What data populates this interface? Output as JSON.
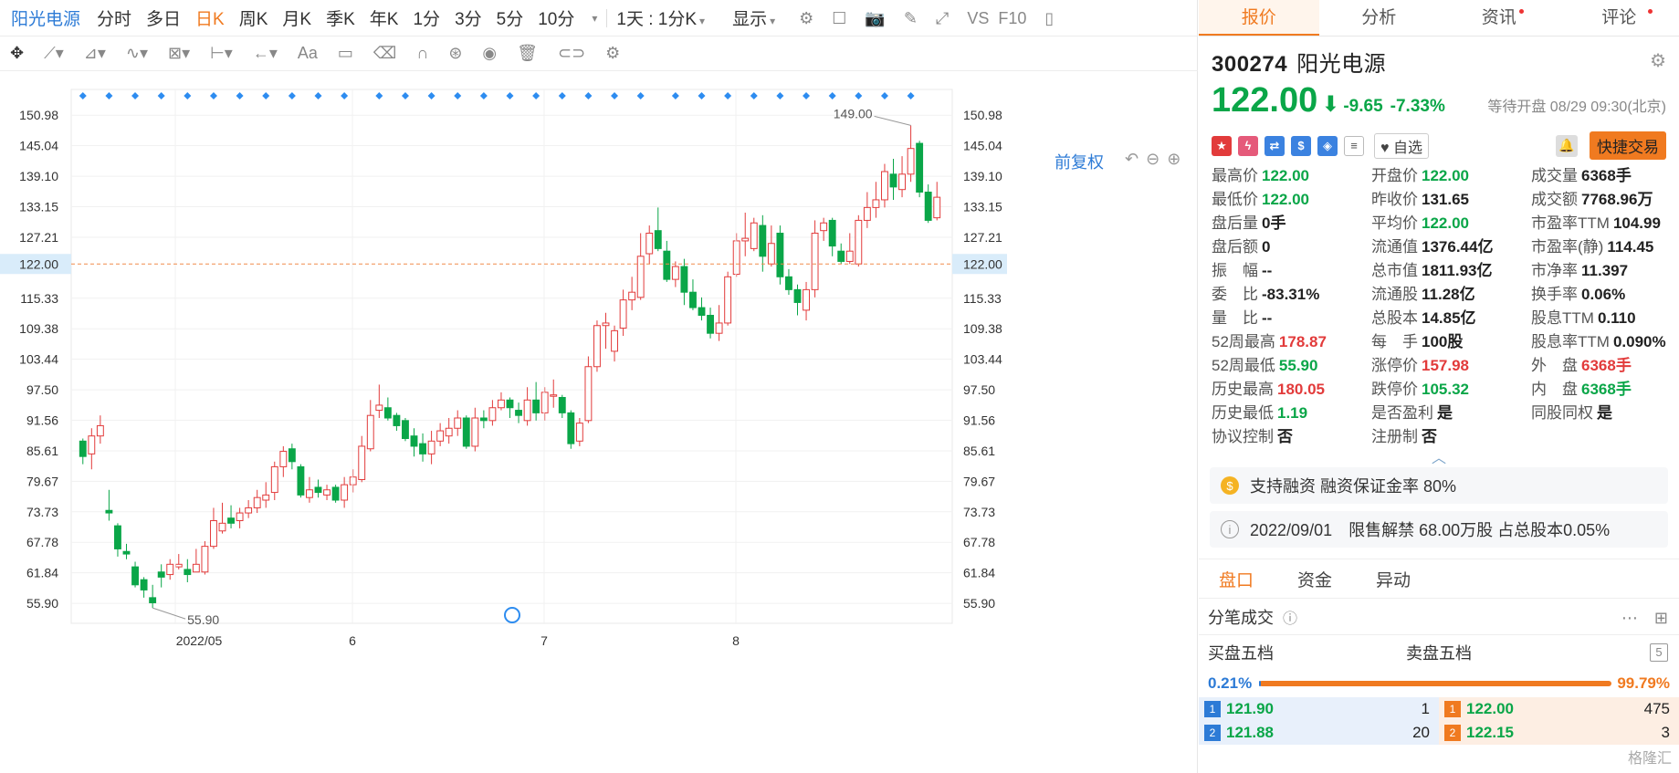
{
  "toolbar": {
    "stock_name": "阳光电源",
    "periods": [
      "分时",
      "多日",
      "日K",
      "周K",
      "月K",
      "季K",
      "年K",
      "1分",
      "3分",
      "5分",
      "10分"
    ],
    "active_period": "日K",
    "range_select": "1天 : 1分K",
    "display_label": "显示",
    "vs_label": "VS",
    "f10_label": "F10"
  },
  "chart": {
    "fuquan_label": "前复权"
  },
  "chart_data": {
    "type": "candlestick",
    "x_labels": [
      "2022/05",
      "6",
      "7",
      "8"
    ],
    "y_ticks": [
      150.98,
      145.04,
      139.1,
      133.15,
      127.21,
      122.0,
      115.33,
      109.38,
      103.44,
      97.5,
      91.56,
      85.61,
      79.67,
      73.73,
      67.78,
      61.84,
      55.9
    ],
    "current_price": 122.0,
    "high_label": "149.00",
    "low_label": "55.90",
    "ylim": [
      52.0,
      156.0
    ],
    "candles": [
      [
        87.5,
        84.5,
        88.0,
        83.0
      ],
      [
        85.0,
        88.5,
        90.0,
        82.0
      ],
      [
        88.5,
        90.5,
        92.5,
        87.0
      ],
      [
        74.0,
        73.5,
        78.0,
        72.0
      ],
      [
        71.0,
        66.5,
        71.5,
        65.0
      ],
      [
        66.0,
        65.5,
        67.5,
        64.5
      ],
      [
        63.0,
        59.5,
        64.0,
        59.0
      ],
      [
        60.5,
        58.5,
        61.0,
        57.0
      ],
      [
        57.0,
        56.0,
        59.5,
        55.0
      ],
      [
        62.0,
        61.0,
        63.5,
        59.0
      ],
      [
        61.5,
        63.5,
        64.5,
        60.5
      ],
      [
        63.0,
        63.5,
        65.5,
        62.5
      ],
      [
        62.5,
        61.5,
        64.5,
        60.0
      ],
      [
        62.0,
        63.5,
        66.5,
        62.0
      ],
      [
        62.0,
        67.0,
        68.0,
        61.5
      ],
      [
        67.0,
        72.0,
        74.5,
        66.5
      ],
      [
        70.0,
        71.5,
        75.5,
        69.5
      ],
      [
        72.5,
        71.5,
        75.0,
        70.5
      ],
      [
        72.0,
        73.5,
        74.5,
        70.5
      ],
      [
        73.5,
        74.5,
        76.0,
        72.5
      ],
      [
        74.5,
        76.5,
        78.0,
        73.5
      ],
      [
        76.0,
        77.0,
        79.5,
        74.5
      ],
      [
        77.5,
        82.5,
        83.5,
        76.0
      ],
      [
        82.5,
        85.5,
        86.5,
        80.5
      ],
      [
        86.0,
        83.5,
        87.0,
        82.0
      ],
      [
        82.5,
        77.0,
        83.0,
        76.5
      ],
      [
        76.5,
        78.0,
        80.5,
        75.5
      ],
      [
        78.5,
        77.5,
        80.0,
        76.5
      ],
      [
        77.0,
        78.0,
        79.0,
        76.0
      ],
      [
        78.5,
        76.0,
        79.0,
        75.5
      ],
      [
        76.0,
        79.0,
        80.5,
        74.5
      ],
      [
        79.0,
        80.5,
        82.0,
        77.5
      ],
      [
        80.0,
        86.5,
        88.5,
        79.5
      ],
      [
        86.0,
        92.5,
        95.5,
        85.5
      ],
      [
        93.5,
        94.5,
        98.5,
        92.0
      ],
      [
        94.0,
        92.0,
        96.0,
        91.5
      ],
      [
        92.5,
        90.5,
        93.0,
        89.5
      ],
      [
        91.5,
        88.0,
        92.0,
        87.5
      ],
      [
        88.5,
        86.5,
        90.0,
        84.5
      ],
      [
        87.0,
        85.0,
        89.0,
        83.5
      ],
      [
        85.0,
        87.5,
        89.5,
        83.0
      ],
      [
        87.5,
        89.5,
        91.0,
        86.5
      ],
      [
        88.5,
        90.0,
        92.0,
        87.0
      ],
      [
        90.0,
        92.0,
        93.5,
        88.5
      ],
      [
        92.0,
        86.5,
        92.5,
        86.0
      ],
      [
        86.5,
        92.0,
        94.0,
        85.5
      ],
      [
        92.0,
        91.5,
        93.5,
        90.0
      ],
      [
        91.5,
        94.0,
        95.5,
        90.5
      ],
      [
        94.0,
        95.5,
        97.0,
        93.5
      ],
      [
        95.5,
        94.0,
        96.0,
        92.0
      ],
      [
        93.5,
        92.5,
        95.0,
        91.0
      ],
      [
        91.5,
        95.5,
        98.0,
        90.5
      ],
      [
        95.5,
        93.0,
        99.0,
        91.5
      ],
      [
        93.0,
        97.0,
        98.0,
        91.5
      ],
      [
        96.5,
        96.5,
        99.5,
        94.0
      ],
      [
        96.0,
        93.0,
        96.5,
        92.0
      ],
      [
        93.0,
        87.0,
        93.5,
        86.0
      ],
      [
        87.5,
        91.0,
        92.0,
        86.5
      ],
      [
        91.5,
        102.0,
        104.0,
        91.0
      ],
      [
        102.0,
        110.0,
        111.0,
        101.0
      ],
      [
        110.0,
        110.5,
        112.5,
        105.5
      ],
      [
        105.0,
        109.0,
        110.0,
        103.0
      ],
      [
        109.5,
        115.0,
        117.0,
        108.0
      ],
      [
        115.0,
        116.5,
        119.5,
        113.0
      ],
      [
        115.5,
        123.5,
        128.0,
        115.0
      ],
      [
        124.0,
        128.0,
        129.5,
        122.0
      ],
      [
        128.5,
        125.0,
        133.0,
        124.5
      ],
      [
        124.5,
        119.0,
        126.5,
        118.5
      ],
      [
        119.0,
        121.5,
        122.5,
        117.5
      ],
      [
        121.5,
        116.5,
        123.0,
        114.0
      ],
      [
        116.5,
        113.5,
        119.0,
        113.0
      ],
      [
        113.5,
        112.0,
        115.5,
        111.0
      ],
      [
        112.0,
        108.5,
        113.5,
        107.5
      ],
      [
        108.5,
        110.5,
        114.0,
        107.0
      ],
      [
        110.5,
        119.5,
        120.5,
        110.0
      ],
      [
        120.0,
        126.5,
        128.0,
        119.5
      ],
      [
        126.5,
        127.0,
        132.0,
        123.5
      ],
      [
        125.0,
        130.0,
        131.0,
        124.5
      ],
      [
        129.5,
        123.5,
        131.5,
        120.5
      ],
      [
        122.0,
        126.0,
        129.5,
        121.5
      ],
      [
        128.0,
        119.5,
        129.5,
        118.0
      ],
      [
        119.5,
        117.0,
        121.0,
        116.0
      ],
      [
        117.0,
        114.5,
        118.0,
        112.0
      ],
      [
        113.0,
        117.0,
        118.5,
        111.0
      ],
      [
        117.0,
        128.0,
        130.5,
        115.5
      ],
      [
        128.5,
        130.0,
        131.0,
        126.5
      ],
      [
        130.5,
        125.5,
        131.0,
        123.5
      ],
      [
        124.5,
        122.5,
        126.0,
        122.0
      ],
      [
        122.5,
        124.5,
        128.0,
        122.0
      ],
      [
        122.0,
        130.5,
        131.5,
        121.5
      ],
      [
        130.5,
        133.0,
        136.0,
        129.0
      ],
      [
        133.0,
        134.5,
        138.0,
        131.0
      ],
      [
        134.5,
        140.0,
        141.5,
        133.0
      ],
      [
        139.5,
        137.0,
        142.5,
        134.5
      ],
      [
        136.5,
        139.5,
        143.0,
        135.0
      ],
      [
        139.5,
        144.5,
        149.0,
        138.0
      ],
      [
        145.5,
        136.0,
        146.0,
        135.0
      ],
      [
        136.0,
        130.5,
        137.5,
        130.0
      ],
      [
        131.0,
        135.0,
        138.0,
        130.5
      ]
    ],
    "markers_count": 32
  },
  "quote": {
    "code": "300274",
    "name": "阳光电源",
    "price": "122.00",
    "change": "-9.65",
    "change_pct": "-7.33%",
    "status": "等待开盘 08/29 09:30(北京)",
    "watch_label": "自选",
    "trade_label": "快捷交易"
  },
  "tabs": [
    "报价",
    "分析",
    "资讯",
    "评论"
  ],
  "active_tab": "报价",
  "stats": [
    [
      {
        "l": "最高价",
        "v": "122.00",
        "c": "g"
      },
      {
        "l": "开盘价",
        "v": "122.00",
        "c": "g"
      },
      {
        "l": "成交量",
        "v": "6368手",
        "c": ""
      }
    ],
    [
      {
        "l": "最低价",
        "v": "122.00",
        "c": "g"
      },
      {
        "l": "昨收价",
        "v": "131.65",
        "c": ""
      },
      {
        "l": "成交额",
        "v": "7768.96万",
        "c": ""
      }
    ],
    [
      {
        "l": "盘后量",
        "v": "0手",
        "c": ""
      },
      {
        "l": "平均价",
        "v": "122.00",
        "c": "g"
      },
      {
        "l": "市盈率TTM",
        "v": "104.99",
        "c": ""
      }
    ],
    [
      {
        "l": "盘后额",
        "v": "0",
        "c": ""
      },
      {
        "l": "流通值",
        "v": "1376.44亿",
        "c": ""
      },
      {
        "l": "市盈率(静)",
        "v": "114.45",
        "c": ""
      }
    ],
    [
      {
        "l": "振　幅",
        "v": "--",
        "c": ""
      },
      {
        "l": "总市值",
        "v": "1811.93亿",
        "c": ""
      },
      {
        "l": "市净率",
        "v": "11.397",
        "c": ""
      }
    ],
    [
      {
        "l": "委　比",
        "v": "-83.31%",
        "c": ""
      },
      {
        "l": "流通股",
        "v": "11.28亿",
        "c": ""
      },
      {
        "l": "换手率",
        "v": "0.06%",
        "c": ""
      }
    ],
    [
      {
        "l": "量　比",
        "v": "--",
        "c": ""
      },
      {
        "l": "总股本",
        "v": "14.85亿",
        "c": ""
      },
      {
        "l": "股息TTM",
        "v": "0.110",
        "c": ""
      }
    ],
    [
      {
        "l": "52周最高",
        "v": "178.87",
        "c": "r"
      },
      {
        "l": "每　手",
        "v": "100股",
        "c": ""
      },
      {
        "l": "股息率TTM",
        "v": "0.090%",
        "c": ""
      }
    ],
    [
      {
        "l": "52周最低",
        "v": "55.90",
        "c": "g"
      },
      {
        "l": "涨停价",
        "v": "157.98",
        "c": "r"
      },
      {
        "l": "外　盘",
        "v": "6368手",
        "c": "r"
      }
    ],
    [
      {
        "l": "历史最高",
        "v": "180.05",
        "c": "r"
      },
      {
        "l": "跌停价",
        "v": "105.32",
        "c": "g"
      },
      {
        "l": "内　盘",
        "v": "6368手",
        "c": "g"
      }
    ],
    [
      {
        "l": "历史最低",
        "v": "1.19",
        "c": "g"
      },
      {
        "l": "是否盈利",
        "v": "是",
        "c": ""
      },
      {
        "l": "同股同权",
        "v": "是",
        "c": ""
      }
    ],
    [
      {
        "l": "协议控制",
        "v": "否",
        "c": ""
      },
      {
        "l": "注册制",
        "v": "否",
        "c": ""
      },
      {
        "l": "",
        "v": "",
        "c": ""
      }
    ]
  ],
  "notices": [
    {
      "text": "支持融资 融资保证金率 80%"
    },
    {
      "text": "2022/09/01　限售解禁 68.00万股 占总股本0.05%"
    }
  ],
  "subtabs": [
    "盘口",
    "资金",
    "异动"
  ],
  "active_subtab": "盘口",
  "fenbi_label": "分笔成交",
  "book": {
    "buy_label": "买盘五档",
    "sell_label": "卖盘五档",
    "buy_pct": "0.21%",
    "sell_pct": "99.79%",
    "buy_ratio": 0.0021,
    "rows": [
      {
        "bl": "1",
        "bp": "121.90",
        "bq": "1",
        "sl": "1",
        "sp": "122.00",
        "sq": "475"
      },
      {
        "bl": "2",
        "bp": "121.88",
        "bq": "20",
        "sl": "2",
        "sp": "122.15",
        "sq": "3"
      }
    ]
  },
  "watermark": "格隆汇",
  "colors": {
    "up": "#e23b3b",
    "down": "#0aa648",
    "accent": "#f07a20",
    "link": "#2d7bd6"
  }
}
